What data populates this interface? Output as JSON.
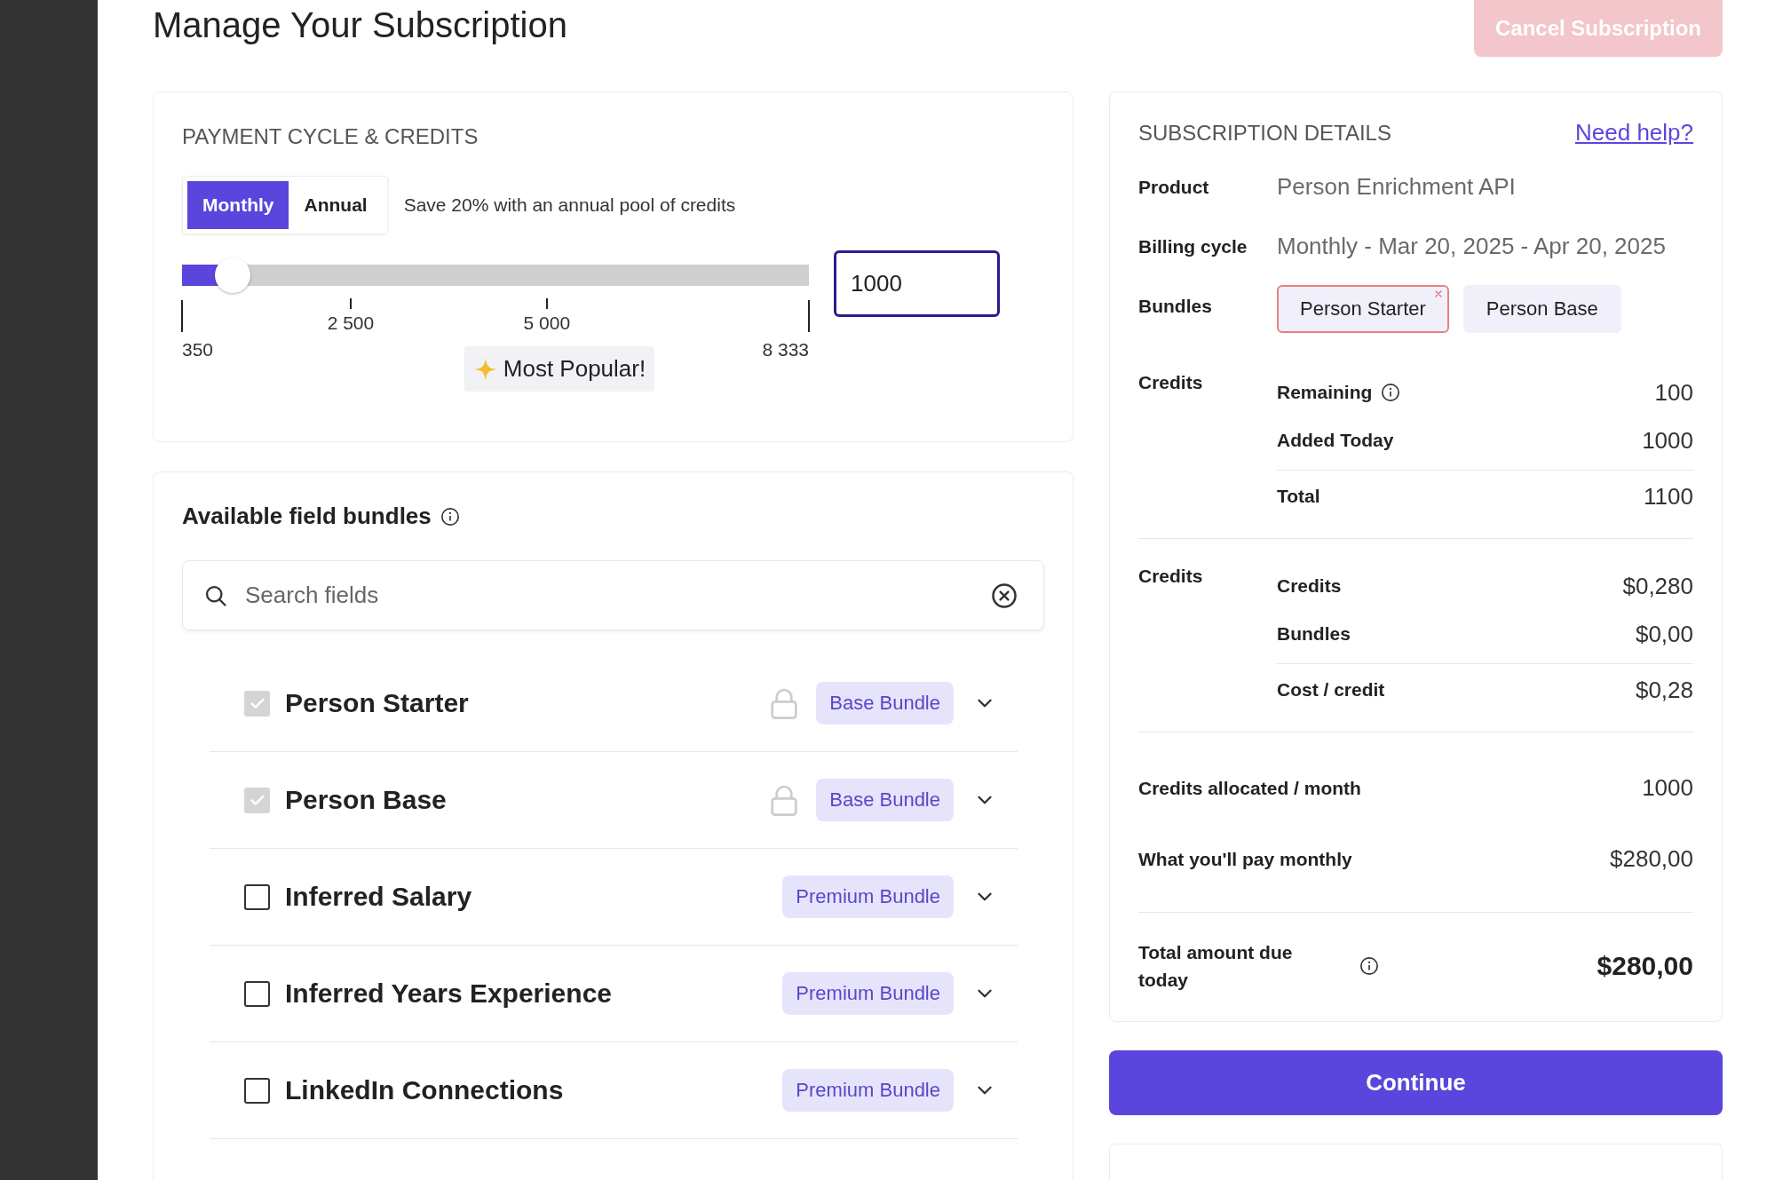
{
  "title": "Manage Your Subscription",
  "cancel_button": {
    "label": "Cancel Subscription",
    "disabled": true
  },
  "payment_card": {
    "heading": "PAYMENT CYCLE & CREDITS",
    "cycle_tabs": [
      {
        "label": "Monthly",
        "selected": true
      },
      {
        "label": "Annual",
        "selected": false
      }
    ],
    "hint": "Save 20% with an annual pool of credits",
    "slider": {
      "level": 0.081,
      "ticks": [
        {
          "label": "350",
          "kind": "end"
        },
        {
          "label": "2 500",
          "kind": "mid"
        },
        {
          "label": "5 000",
          "kind": "mid"
        },
        {
          "label": "8 333",
          "kind": "end"
        }
      ],
      "badge": "Most Popular!"
    },
    "credits_input": {
      "value": "1000"
    }
  },
  "bundles_card": {
    "heading": "Available field bundles",
    "search": {
      "placeholder": "Search fields"
    },
    "items": [
      {
        "name": "Person Starter",
        "checked": true,
        "disabled": true,
        "locked": true,
        "badge": "Base Bundle"
      },
      {
        "name": "Person Base",
        "checked": true,
        "disabled": true,
        "locked": true,
        "badge": "Base Bundle"
      },
      {
        "name": "Inferred Salary",
        "checked": false,
        "disabled": false,
        "locked": false,
        "badge": "Premium Bundle"
      },
      {
        "name": "Inferred Years Experience",
        "checked": false,
        "disabled": false,
        "locked": false,
        "badge": "Premium Bundle"
      },
      {
        "name": "LinkedIn Connections",
        "checked": false,
        "disabled": false,
        "locked": false,
        "badge": "Premium Bundle"
      }
    ]
  },
  "details_card": {
    "heading": "SUBSCRIPTION DETAILS",
    "help_link": "Need help?",
    "rows": [
      {
        "label": "Product",
        "kind": "text",
        "value": "Person Enrichment API"
      },
      {
        "label": "Billing cycle",
        "kind": "text",
        "value": "Monthly - Mar 20, 2025 - Apr 20, 2025"
      },
      {
        "label": "Bundles",
        "kind": "tags",
        "tags": [
          {
            "label": "Person Starter",
            "removable": true
          },
          {
            "label": "Person Base",
            "removable": false
          }
        ]
      },
      {
        "label": "Credits",
        "kind": "breakdown",
        "lines": [
          {
            "label": "Remaining",
            "value": "100",
            "info": true,
            "divider_above": false
          },
          {
            "label": "Added Today",
            "value": "1000",
            "info": false,
            "divider_above": false
          },
          {
            "label": "Total",
            "value": "1100",
            "info": false,
            "divider_above": true
          }
        ]
      },
      {
        "label": "Credits",
        "kind": "breakdown",
        "lines": [
          {
            "label": "Credits",
            "value": "$0,280",
            "info": false,
            "divider_above": false
          },
          {
            "label": "Bundles",
            "value": "$0,00",
            "info": false,
            "divider_above": false
          },
          {
            "label": "Cost / credit",
            "value": "$0,28",
            "info": false,
            "divider_above": true
          }
        ]
      }
    ],
    "summary": [
      {
        "label": "Credits allocated / month",
        "value": "1000",
        "info": false,
        "emphasis": false,
        "divider_above": false
      },
      {
        "label": "What you'll pay monthly",
        "value": "$280,00",
        "info": false,
        "emphasis": false,
        "divider_above": false
      },
      {
        "label": "Total amount due today",
        "value": "$280,00",
        "info": true,
        "emphasis": true,
        "divider_above": true
      }
    ]
  },
  "continue_button": {
    "label": "Continue"
  }
}
